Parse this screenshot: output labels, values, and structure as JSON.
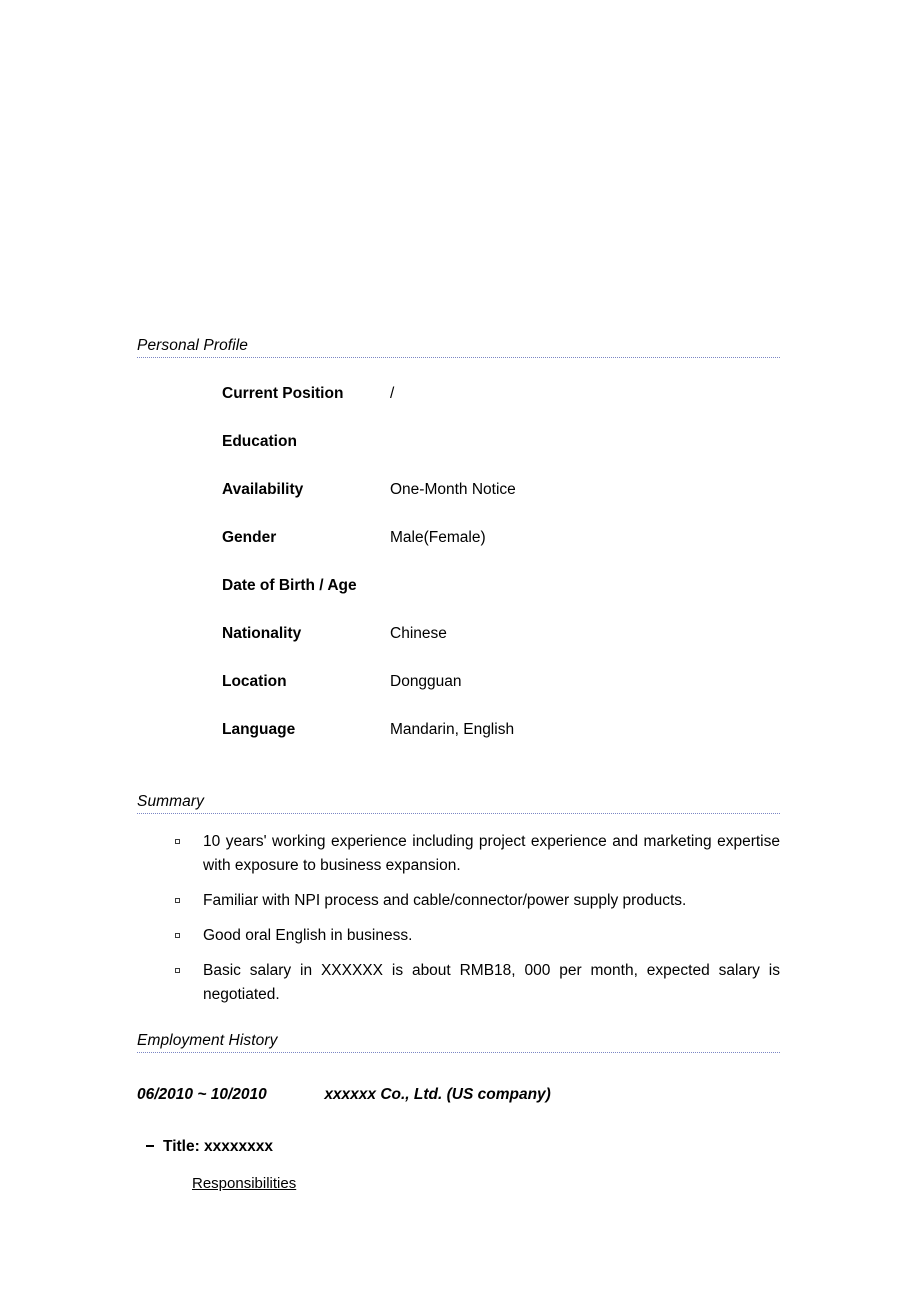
{
  "document": {
    "sections": [
      {
        "id": "personal-profile",
        "heading": "Personal Profile"
      },
      {
        "id": "summary",
        "heading": "Summary"
      },
      {
        "id": "employment-history",
        "heading": "Employment History"
      }
    ]
  },
  "personal_profile": {
    "heading": "Personal Profile",
    "fields": [
      {
        "label": "Current Position",
        "value": "/"
      },
      {
        "label": "Education",
        "value": ""
      },
      {
        "label": "Availability",
        "value": "One-Month Notice"
      },
      {
        "label": "Gender",
        "value": "Male(Female)"
      },
      {
        "label": "Date of Birth / Age",
        "value": ""
      },
      {
        "label": "Nationality",
        "value": "Chinese"
      },
      {
        "label": "Location",
        "value": "Dongguan"
      },
      {
        "label": "Language",
        "value": "Mandarin, English"
      }
    ]
  },
  "summary": {
    "heading": "Summary",
    "bullets": [
      "10 years' working experience including project experience and marketing expertise with exposure to business expansion.",
      "Familiar with NPI process and cable/connector/power supply products.",
      "Good oral English in business.",
      "Basic salary in XXXXXX is about RMB18, 000 per month, expected salary is negotiated."
    ]
  },
  "employment_history": {
    "heading": "Employment History",
    "jobs": [
      {
        "dates": "06/2010 ~ 10/2010",
        "company": "xxxxxx Co., Ltd. (US company)",
        "title": "Title: xxxxxxxx",
        "responsibilities_label": "Responsibilities"
      }
    ]
  },
  "style": {
    "separator_color": "#7b86c4",
    "text_color": "#000000",
    "page_background": "#ffffff"
  }
}
